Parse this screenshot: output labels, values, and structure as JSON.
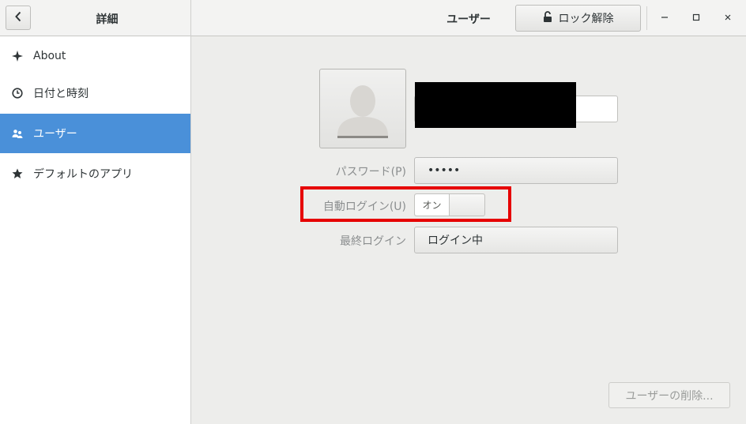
{
  "header": {
    "left_title": "詳細",
    "title": "ユーザー",
    "unlock_label": "ロック解除"
  },
  "sidebar": {
    "items": [
      {
        "label": "About",
        "icon": "sparkle-icon"
      },
      {
        "label": "日付と時刻",
        "icon": "clock-icon"
      },
      {
        "label": "ユーザー",
        "icon": "users-icon",
        "selected": true
      },
      {
        "label": "デフォルトのアプリ",
        "icon": "star-icon"
      }
    ]
  },
  "user": {
    "password_label": "パスワード(P)",
    "password_value": "•••••",
    "autologin_label": "自動ログイン(U)",
    "autologin_state": "オン",
    "last_login_label": "最終ログイン",
    "last_login_value": "ログイン中",
    "remove_button": "ユーザーの削除..."
  },
  "colors": {
    "accent": "#4a90d9",
    "highlight": "#e60000"
  }
}
